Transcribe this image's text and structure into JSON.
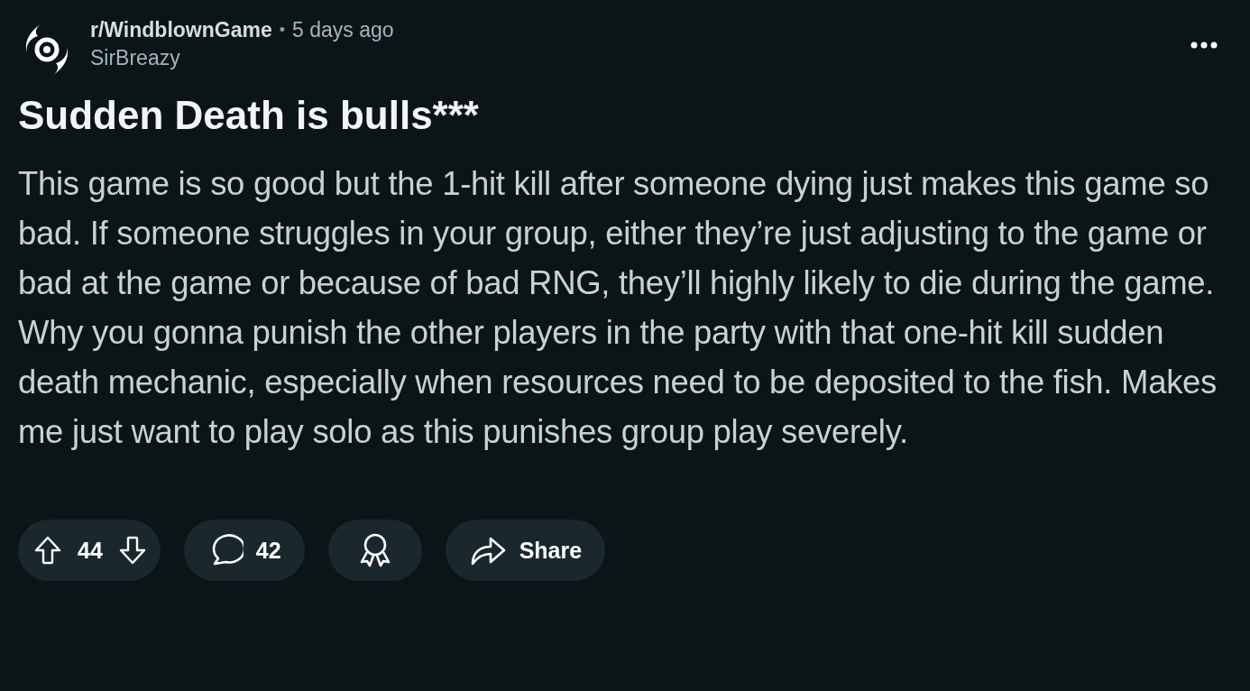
{
  "post": {
    "subreddit": "r/WindblownGame",
    "separator": "•",
    "time": "5 days ago",
    "author": "SirBreazy",
    "title": "Sudden Death is bulls***",
    "body": "This game is so good but the 1-hit kill after someone dying just makes this game so bad. If someone struggles in your group, either they’re just adjusting to the game or bad at the game or because of bad RNG, they’ll highly likely to die during the game. Why you gonna punish the other players in the party with that one-hit kill sudden death mechanic, especially when resources need to be deposited to the fish. Makes me just want to play solo as this punishes group play severely."
  },
  "actions": [
    {
      "kind": "vote",
      "label": "44"
    },
    {
      "kind": "comments",
      "label": "42"
    },
    {
      "kind": "award"
    },
    {
      "kind": "share",
      "label": "Share"
    }
  ]
}
